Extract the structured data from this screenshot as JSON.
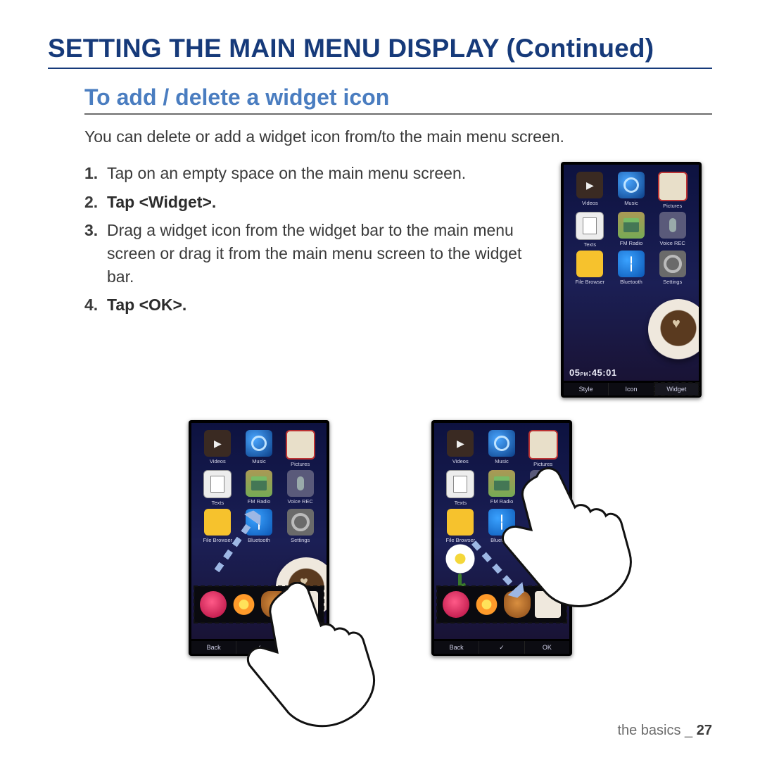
{
  "heading": "SETTING THE MAIN MENU DISPLAY (Continued)",
  "subheading": "To add / delete a widget icon",
  "intro": "You can delete or add a widget icon from/to the main menu screen.",
  "steps": [
    {
      "num": "1.",
      "text": "Tap on an empty space on the main menu screen.",
      "bold": false
    },
    {
      "num": "2.",
      "text": "Tap <Widget>.",
      "bold": true
    },
    {
      "num": "3.",
      "text": "Drag a widget icon from the widget bar to the main menu screen or drag it from the main menu screen to the widget bar.",
      "bold": false
    },
    {
      "num": "4.",
      "text": "Tap <OK>.",
      "bold": true
    }
  ],
  "apps": [
    {
      "id": "videos",
      "label": "Videos"
    },
    {
      "id": "music",
      "label": "Music"
    },
    {
      "id": "pictures",
      "label": "Pictures"
    },
    {
      "id": "texts",
      "label": "Texts"
    },
    {
      "id": "radio",
      "label": "FM Radio"
    },
    {
      "id": "voice",
      "label": "Voice REC"
    },
    {
      "id": "files",
      "label": "File Browser"
    },
    {
      "id": "bt",
      "label": "Bluetooth"
    },
    {
      "id": "settings",
      "label": "Settings"
    }
  ],
  "clock": {
    "hour": "05",
    "min": "45",
    "sec": "01",
    "ampm": "PM"
  },
  "topbar": {
    "a": "Style",
    "b": "Icon",
    "c": "Widget"
  },
  "lowbar": {
    "a": "Back",
    "b": "",
    "c": "OK"
  },
  "footer": {
    "section": "the basics",
    "sep": " _ ",
    "page": "27"
  }
}
